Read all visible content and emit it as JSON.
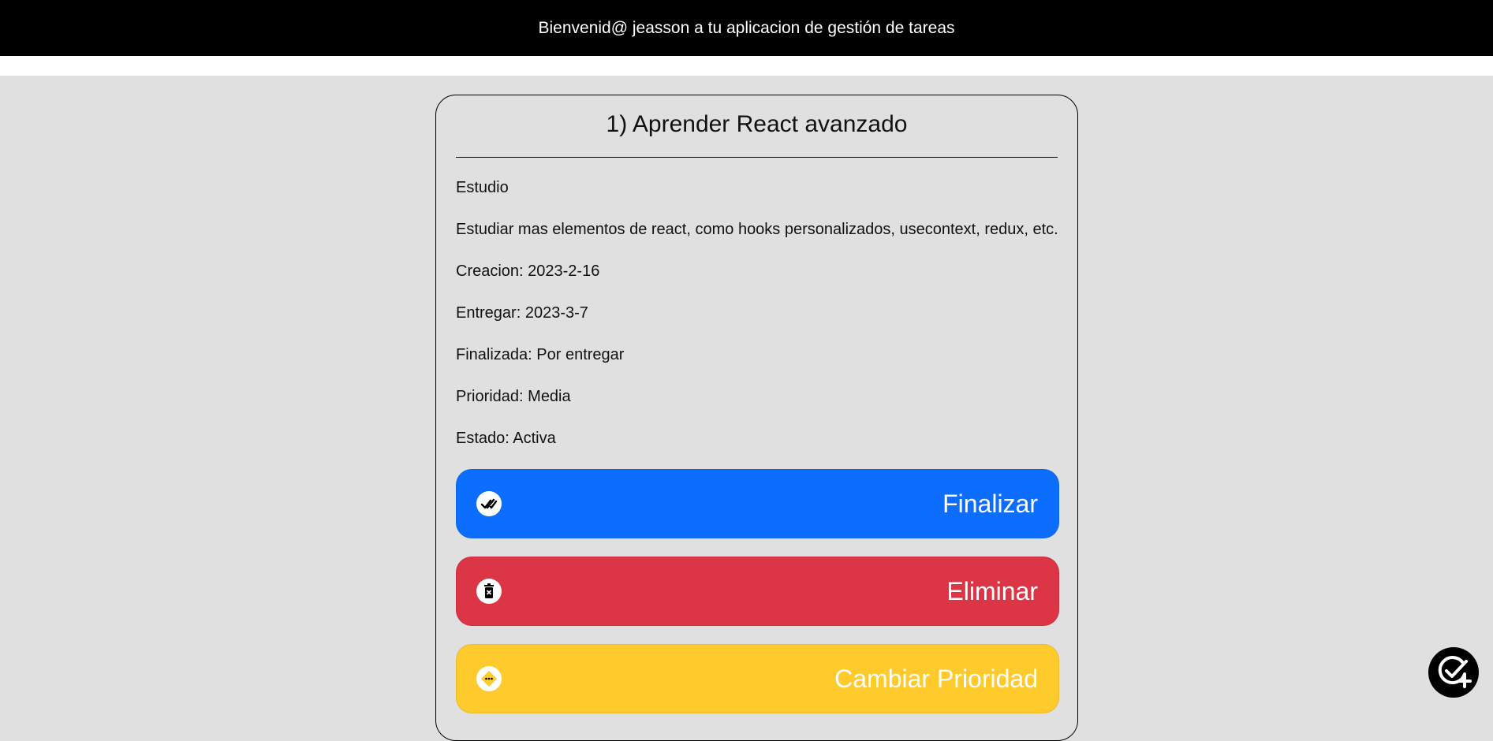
{
  "header": {
    "welcome_text": "Bienvenid@ jeasson a tu aplicacion de gestión de tareas"
  },
  "task": {
    "title": "1) Aprender React avanzado",
    "category": "Estudio",
    "description": "Estudiar mas elementos de react, como hooks personalizados, usecontext, redux, etc.",
    "created": "Creacion: 2023-2-16",
    "due": "Entregar: 2023-3-7",
    "finished": "Finalizada: Por entregar",
    "priority": "Prioridad: Media",
    "status": "Estado: Activa"
  },
  "actions": {
    "finish_label": "Finalizar",
    "finish_icon": "double-check-icon",
    "delete_label": "Eliminar",
    "delete_icon": "trash-icon",
    "priority_label": "Cambiar Prioridad",
    "priority_icon": "priority-diamond-icon"
  },
  "fab": {
    "icon": "add-task-icon"
  },
  "colors": {
    "header_bg": "#000000",
    "page_bg": "#e0e0e0",
    "finish": "#0d6efd",
    "delete": "#dc3545",
    "priority": "#ffca2c"
  }
}
